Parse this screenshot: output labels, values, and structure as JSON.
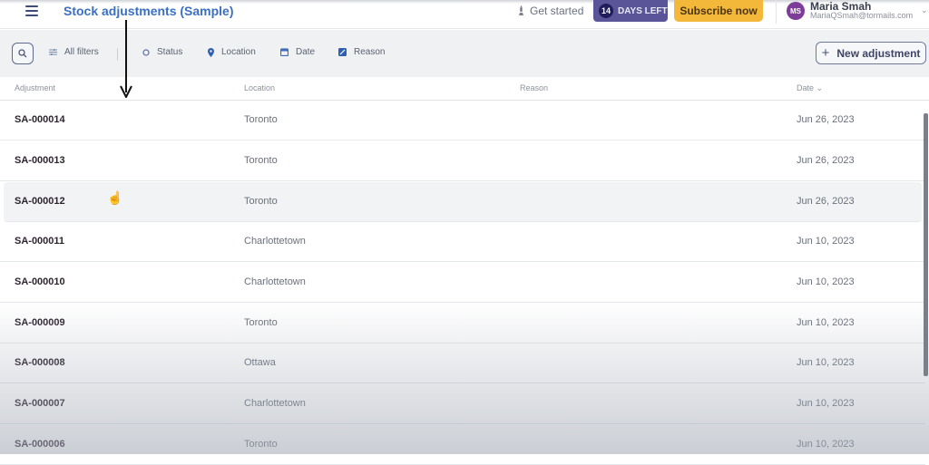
{
  "header": {
    "title": "Stock adjustments (Sample)",
    "get_started": "Get started",
    "trial_days": "14",
    "trial_label": "DAYS LEFT",
    "subscribe": "Subscribe now",
    "user": {
      "initials": "MS",
      "name": "Maria Smah",
      "email": "MariaQSmah@tormails.com"
    },
    "colors": {
      "title": "#3b6fc4",
      "trial_bg": "#5a5499",
      "subscribe_bg": "#f3b73a",
      "avatar_bg": "#7d3c98"
    }
  },
  "filters": {
    "all_filters": "All filters",
    "items": [
      {
        "label": "Status",
        "icon": "circle-icon"
      },
      {
        "label": "Location",
        "icon": "map-pin-icon"
      },
      {
        "label": "Date",
        "icon": "calendar-icon"
      },
      {
        "label": "Reason",
        "icon": "edit-icon"
      }
    ],
    "new_button": "New adjustment"
  },
  "table": {
    "columns": [
      "Adjustment",
      "Location",
      "Reason",
      "Date"
    ],
    "sort_column": "Date",
    "rows": [
      {
        "id": "SA-000014",
        "location": "Toronto",
        "reason": "",
        "date": "Jun 26, 2023"
      },
      {
        "id": "SA-000013",
        "location": "Toronto",
        "reason": "",
        "date": "Jun 26, 2023"
      },
      {
        "id": "SA-000012",
        "location": "Toronto",
        "reason": "",
        "date": "Jun 26, 2023"
      },
      {
        "id": "SA-000011",
        "location": "Charlottetown",
        "reason": "",
        "date": "Jun 10, 2023"
      },
      {
        "id": "SA-000010",
        "location": "Charlottetown",
        "reason": "",
        "date": "Jun 10, 2023"
      },
      {
        "id": "SA-000009",
        "location": "Toronto",
        "reason": "",
        "date": "Jun 10, 2023"
      },
      {
        "id": "SA-000008",
        "location": "Ottawa",
        "reason": "",
        "date": "Jun 10, 2023"
      },
      {
        "id": "SA-000007",
        "location": "Charlottetown",
        "reason": "",
        "date": "Jun 10, 2023"
      },
      {
        "id": "SA-000006",
        "location": "Toronto",
        "reason": "",
        "date": "Jun 10, 2023"
      }
    ]
  }
}
